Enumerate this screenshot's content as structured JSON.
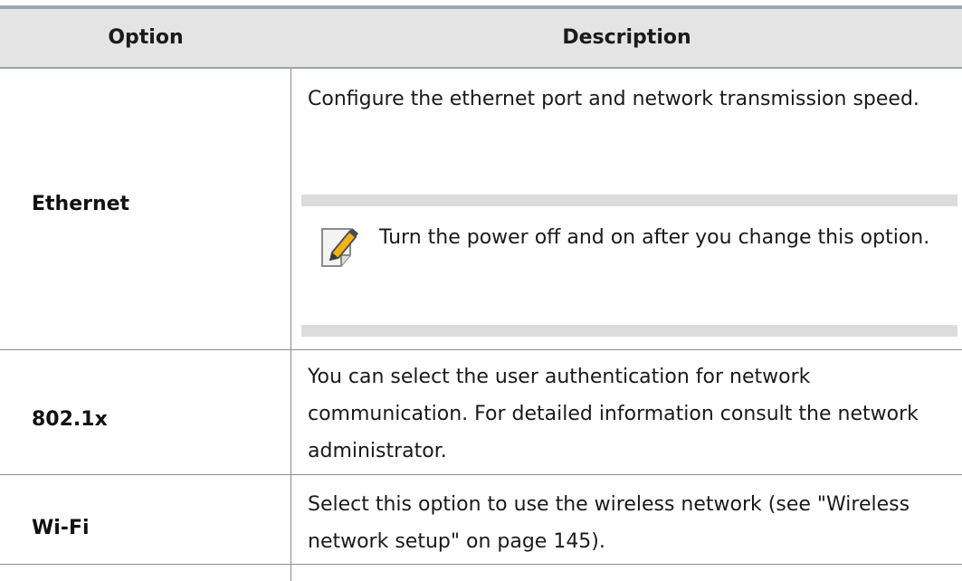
{
  "table": {
    "headers": {
      "option": "Option",
      "description": "Description"
    },
    "rows": [
      {
        "option": "Ethernet",
        "description": "Configure the ethernet port and network transmission speed.",
        "note": "Turn the power off and on after you change this option."
      },
      {
        "option": "802.1x",
        "description": "You can select the user authentication for network communication. For detailed information consult the network administrator."
      },
      {
        "option": "Wi-Fi",
        "description": "Select this option to use the wireless network (see \"Wireless network setup\" on page 145)."
      }
    ]
  },
  "note_icon": "note-pencil-icon"
}
